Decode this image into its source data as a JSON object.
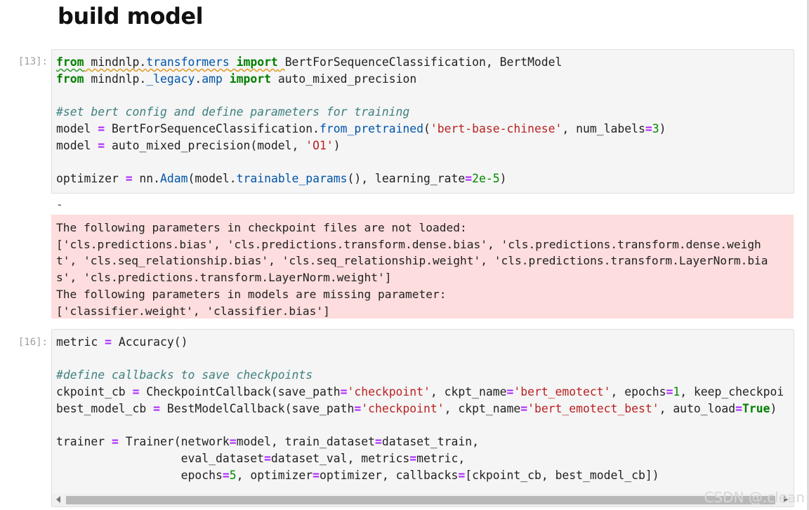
{
  "heading": "build model",
  "cell13": {
    "prompt": "[13]:",
    "lines": [
      "from mindnlp.transformers import BertForSequenceClassification, BertModel",
      "from mindnlp._legacy.amp import auto_mixed_precision",
      "",
      "#set bert config and define parameters for training",
      "model = BertForSequenceClassification.from_pretrained('bert-base-chinese', num_labels=3)",
      "model = auto_mixed_precision(model, 'O1')",
      "",
      "optimizer = nn.Adam(model.trainable_params(), learning_rate=2e-5)"
    ]
  },
  "output13": {
    "marker": "-",
    "stderr": "The following parameters in checkpoint files are not loaded:\n['cls.predictions.bias', 'cls.predictions.transform.dense.bias', 'cls.predictions.transform.dense.weigh\nt', 'cls.seq_relationship.bias', 'cls.seq_relationship.weight', 'cls.predictions.transform.LayerNorm.bia\ns', 'cls.predictions.transform.LayerNorm.weight']\nThe following parameters in models are missing parameter:\n['classifier.weight', 'classifier.bias']"
  },
  "cell16": {
    "prompt": "[16]:",
    "lines": [
      "metric = Accuracy()",
      "",
      "#define callbacks to save checkpoints",
      "ckpoint_cb = CheckpointCallback(save_path='checkpoint', ckpt_name='bert_emotect', epochs=1, keep_checkpoi",
      "best_model_cb = BestModelCallback(save_path='checkpoint', ckpt_name='bert_emotect_best', auto_load=True)",
      "",
      "trainer = Trainer(network=model, train_dataset=dataset_train,",
      "                  eval_dataset=dataset_val, metrics=metric,",
      "                  epochs=5, optimizer=optimizer, callbacks=[ckpoint_cb, best_model_cb])"
    ]
  },
  "watermark": "CSDN @.clean"
}
